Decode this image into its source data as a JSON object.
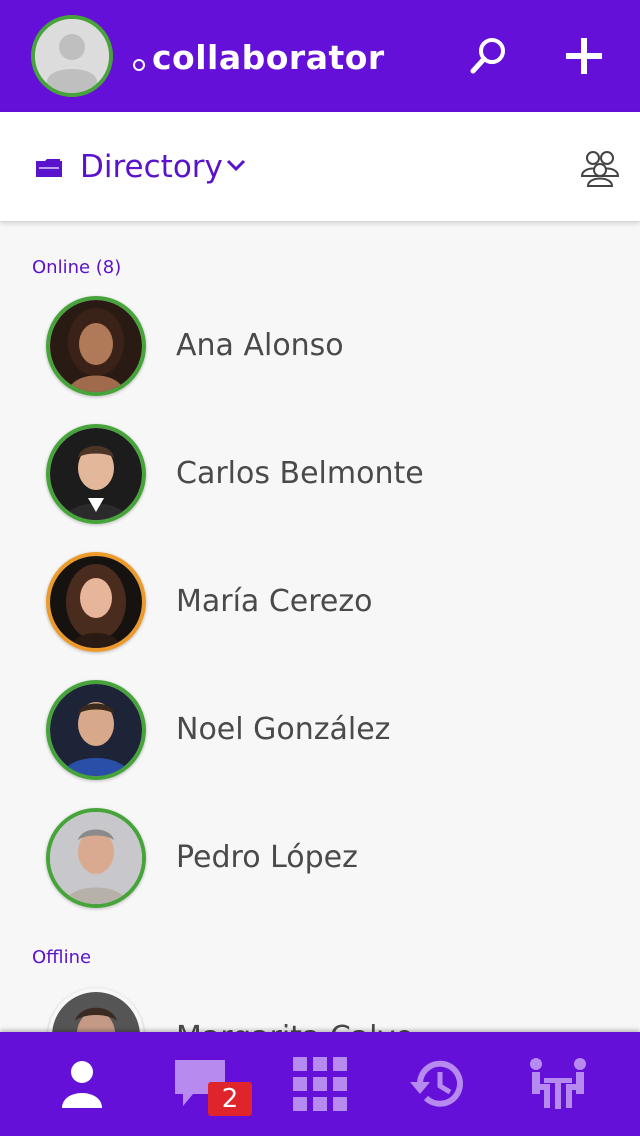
{
  "header": {
    "title": "collaborator",
    "status_color": "#ffffff",
    "brand_color": "#6410d8",
    "avatar_icon": "person-placeholder-icon",
    "actions": [
      {
        "name": "search",
        "icon": "search-icon"
      },
      {
        "name": "add",
        "icon": "plus-icon"
      }
    ]
  },
  "directory_bar": {
    "label": "Directory",
    "icon": "folder-icon",
    "dropdown_icon": "chevron-down-icon",
    "right_icon": "groups-icon"
  },
  "sections": [
    {
      "label": "Online (8)"
    },
    {
      "label": "Offline"
    }
  ],
  "contacts": [
    {
      "name": "Ana Alonso",
      "status": "online",
      "status_color": "#46a43a"
    },
    {
      "name": "Carlos Belmonte",
      "status": "online",
      "status_color": "#46a43a"
    },
    {
      "name": "María Cerezo",
      "status": "away",
      "status_color": "#ec9a2a"
    },
    {
      "name": "Noel González",
      "status": "online",
      "status_color": "#46a43a"
    },
    {
      "name": "Pedro López",
      "status": "online",
      "status_color": "#46a43a"
    },
    {
      "name": "Margarita Calvo",
      "status": "offline",
      "status_color": "#bdbdbd"
    }
  ],
  "bottom_nav": {
    "items": [
      {
        "name": "contacts",
        "icon": "person-icon",
        "active": true
      },
      {
        "name": "chat",
        "icon": "chat-bubble-icon",
        "active": false
      },
      {
        "name": "apps",
        "icon": "grid-icon",
        "active": false
      },
      {
        "name": "history",
        "icon": "history-icon",
        "active": false
      },
      {
        "name": "meetings",
        "icon": "meeting-icon",
        "active": false
      }
    ],
    "chat_badge": "2"
  }
}
